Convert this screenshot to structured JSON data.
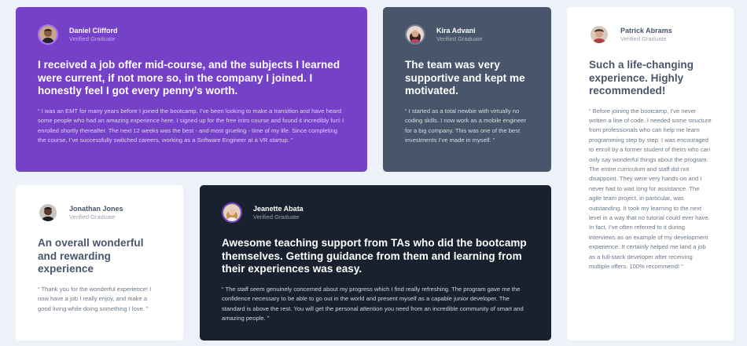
{
  "testimonials": [
    {
      "name": "Daniel Clifford",
      "role": "Verified Graduate",
      "avatar_icon": "daniel-avatar",
      "title": "I received a job offer mid-course, and the subjects I learned were current, if not more so, in the company I joined. I honestly feel I got every penny’s worth.",
      "quote": "“ I was an EMT for many years before I joined the bootcamp. I’ve been looking to make a transition and have heard some people who had an amazing experience here. I signed up for the free intro course and found it incredibly fun! I enrolled shortly thereafter. The next 12 weeks was the best - and most grueling - time of my life. Since completing the course, I’ve successfully switched careers, working as a Software Engineer at a VR startup. ”",
      "background": "#7541c8"
    },
    {
      "name": "Kira Advani",
      "role": "Verified Graduate",
      "avatar_icon": "kira-avatar",
      "title": "The team was very supportive and kept me motivated.",
      "quote": "“ I started as a total newbie with virtually no coding skills. I now work as a mobile engineer for a big company. This was one of the best investments I’ve made in myself. ”",
      "background": "#48556a"
    },
    {
      "name": "Patrick Abrams",
      "role": "Verified Graduate",
      "avatar_icon": "patrick-avatar",
      "title": "Such a life-changing experience. Highly recommended!",
      "quote": "“ Before joining the bootcamp, I’ve never written a line of code. I needed some structure from professionals who can help me learn programming step by step. I was encouraged to enroll by a former student of theirs who can only say wonderful things about the program. The entire curriculum and staff did not disappoint. They were very hands-on and I never had to wait long for assistance. The agile team project, in particular, was outstanding. It took my learning to the next level in a way that no tutorial could ever have. In fact, I’ve often referred to it during interviews as an example of my development experience. It certainly helped me land a job as a full-stack developer after receiving multiple offers. 100% recommend! ”",
      "background": "#ffffff"
    },
    {
      "name": "Jonathan Jones",
      "role": "Verified Graduate",
      "avatar_icon": "jonathan-avatar",
      "title": "An overall wonderful and rewarding experience",
      "quote": "“ Thank you for the wonderful experience! I now have a job I really enjoy, and make a good living while doing something I love. ”",
      "background": "#ffffff"
    },
    {
      "name": "Jeanette Abata",
      "role": "Verified Graduate",
      "avatar_icon": "jeanette-avatar",
      "title": "Awesome teaching support from TAs who did the bootcamp themselves. Getting guidance from them and learning from their experiences was easy.",
      "quote": "“ The staff seem genuinely concerned about my progress which I find really refreshing. The program gave me the confidence necessary to be able to go out in the world and present myself as a capable junior developer. The standard is above the rest. You will get the personal attention you need from an incredible community of smart and amazing people. ”",
      "background": "#19212e"
    }
  ]
}
